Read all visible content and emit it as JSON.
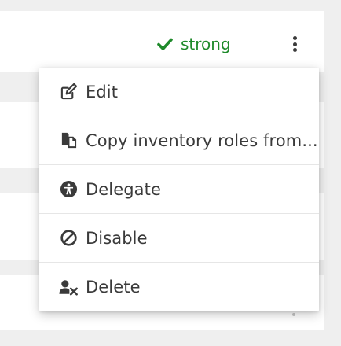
{
  "status": {
    "text": "strong",
    "color": "#1f8a2b",
    "icon": "check-icon"
  },
  "actions_button": {
    "icon": "kebab-menu-icon"
  },
  "menu": {
    "items": [
      {
        "label": "Edit",
        "icon": "edit-icon"
      },
      {
        "label": "Copy inventory roles from...",
        "icon": "copy-icon"
      },
      {
        "label": "Delegate",
        "icon": "delegate-icon"
      },
      {
        "label": "Disable",
        "icon": "disable-icon"
      },
      {
        "label": "Delete",
        "icon": "delete-user-icon"
      }
    ]
  }
}
